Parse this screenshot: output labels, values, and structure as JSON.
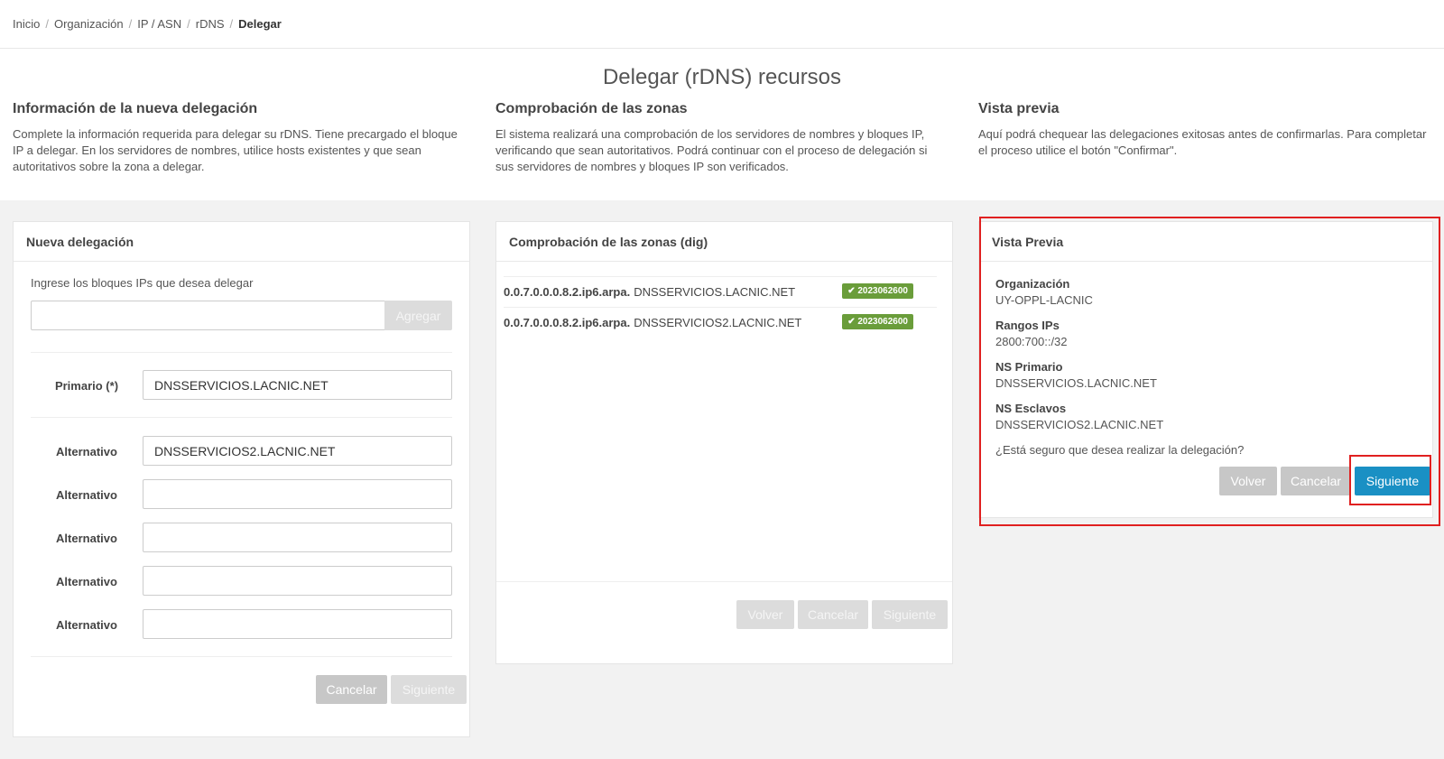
{
  "breadcrumb": [
    "Inicio",
    "Organización",
    "IP / ASN",
    "rDNS",
    "Delegar"
  ],
  "page_title": "Delegar (rDNS) recursos",
  "intro": [
    {
      "title": "Información de la nueva delegación",
      "text": "Complete la información requerida para delegar su rDNS. Tiene precargado el bloque IP a delegar. En los servidores de nombres, utilice hosts existentes y que sean autoritativos sobre la zona a delegar."
    },
    {
      "title": "Comprobación de las zonas",
      "text": "El sistema realizará una comprobación de los servidores de nombres y bloques IP, verificando que sean autoritativos. Podrá continuar con el proceso de delegación si sus servidores de nombres y bloques IP son verificados."
    },
    {
      "title": "Vista previa",
      "text": "Aquí podrá chequear las delegaciones exitosas antes de confirmarlas. Para completar el proceso utilice el botón \"Confirmar\"."
    }
  ],
  "nueva": {
    "title": "Nueva delegación",
    "ip_prompt": "Ingrese los bloques IPs que desea delegar",
    "ip_value": "",
    "add_label": "Agregar",
    "primary_label": "Primario (*)",
    "primary_value": "DNSSERVICIOS.LACNIC.NET",
    "alt_label": "Alternativo",
    "alt_values": [
      "DNSSERVICIOS2.LACNIC.NET",
      "",
      "",
      "",
      ""
    ],
    "cancel_label": "Cancelar",
    "next_label": "Siguiente"
  },
  "zonas": {
    "title": "Comprobación de las zonas (dig)",
    "rows": [
      {
        "zone": "0.0.7.0.0.0.8.2.ip6.arpa.",
        "ns": "DNSSERVICIOS.LACNIC.NET",
        "serial": "2023062600"
      },
      {
        "zone": "0.0.7.0.0.0.8.2.ip6.arpa.",
        "ns": "DNSSERVICIOS2.LACNIC.NET",
        "serial": "2023062600"
      }
    ],
    "back_label": "Volver",
    "cancel_label": "Cancelar",
    "next_label": "Siguiente"
  },
  "preview": {
    "title": "Vista Previa",
    "org_label": "Organización",
    "org_value": "UY-OPPL-LACNIC",
    "ranges_label": "Rangos IPs",
    "ranges_value": "2800:700::/32",
    "ns_primary_label": "NS Primario",
    "ns_primary_value": "DNSSERVICIOS.LACNIC.NET",
    "ns_slaves_label": "NS Esclavos",
    "ns_slaves_value": "DNSSERVICIOS2.LACNIC.NET",
    "question": "¿Está seguro que desea realizar la delegación?",
    "back_label": "Volver",
    "cancel_label": "Cancelar",
    "next_label": "Siguiente"
  },
  "colors": {
    "primary": "#1a90c4",
    "success": "#6a9d3a",
    "highlight": "#e02020"
  }
}
